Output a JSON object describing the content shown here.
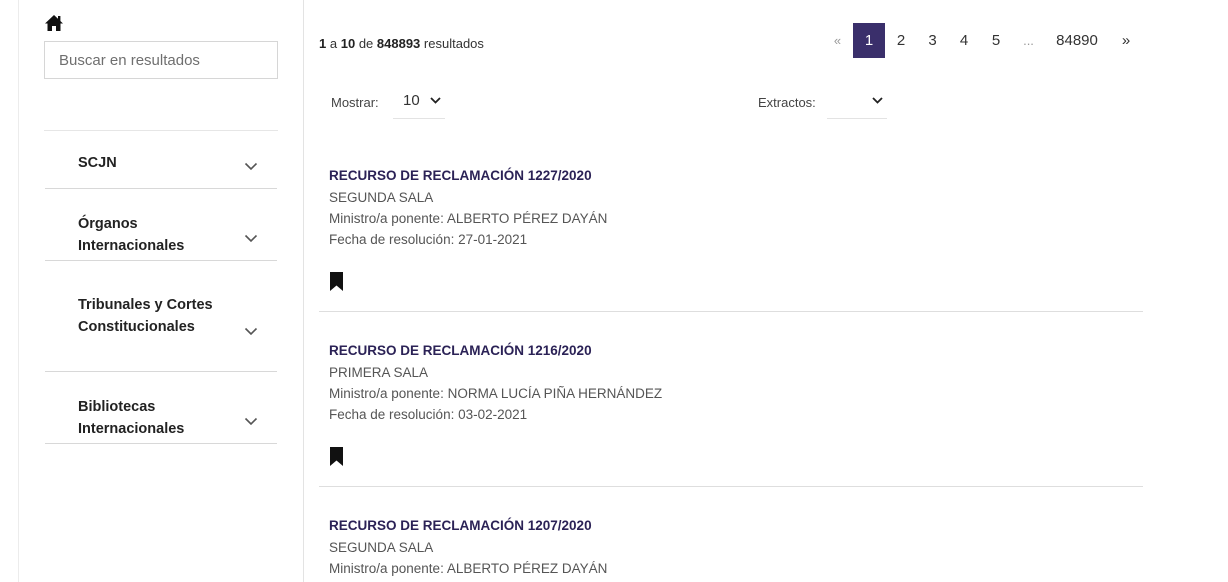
{
  "sidebar": {
    "search_placeholder": "Buscar en resultados",
    "items": [
      {
        "label": "SCJN"
      },
      {
        "label": "Órganos Internacionales"
      },
      {
        "label": "Tribunales y Cortes Constitucionales"
      },
      {
        "label": "Bibliotecas Internacionales"
      }
    ]
  },
  "results_header": {
    "from": "1",
    "sep_a": "a",
    "to": "10",
    "sep_de": "de",
    "total": "848893",
    "suffix": "resultados"
  },
  "pagination": {
    "prev": "«",
    "pages": [
      "1",
      "2",
      "3",
      "4",
      "5"
    ],
    "active": "1",
    "ellipsis": "...",
    "last": "84890",
    "next": "»"
  },
  "controls": {
    "show_label": "Mostrar:",
    "show_value": "10",
    "extract_label": "Extractos:",
    "extract_value": ""
  },
  "results": [
    {
      "title": "RECURSO DE RECLAMACIÓN 1227/2020",
      "sala": "SEGUNDA SALA",
      "ponente": "Ministro/a ponente: ALBERTO PÉREZ DAYÁN",
      "fecha": "Fecha de resolución: 27-01-2021"
    },
    {
      "title": "RECURSO DE RECLAMACIÓN 1216/2020",
      "sala": "PRIMERA SALA",
      "ponente": "Ministro/a ponente: NORMA LUCÍA PIÑA HERNÁNDEZ",
      "fecha": "Fecha de resolución: 03-02-2021"
    },
    {
      "title": "RECURSO DE RECLAMACIÓN 1207/2020",
      "sala": "SEGUNDA SALA",
      "ponente": "Ministro/a ponente: ALBERTO PÉREZ DAYÁN"
    }
  ]
}
